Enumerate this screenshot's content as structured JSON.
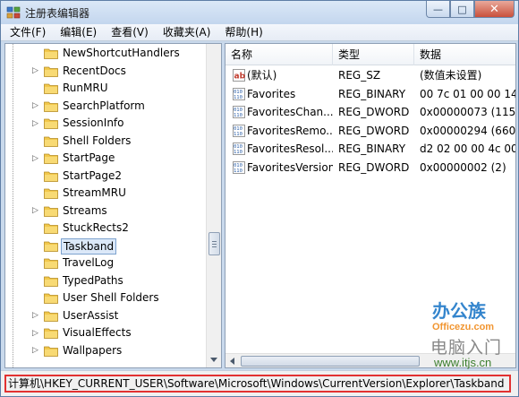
{
  "window": {
    "title": "注册表编辑器",
    "controls": [
      "minimize-icon",
      "maximize-icon",
      "close-icon"
    ],
    "control_glyphs": {
      "minimize": "—",
      "maximize": "□",
      "close": "✕"
    }
  },
  "menu": [
    "文件(F)",
    "编辑(E)",
    "查看(V)",
    "收藏夹(A)",
    "帮助(H)"
  ],
  "tree": {
    "items": [
      {
        "label": "NewShortcutHandlers",
        "expandable": false
      },
      {
        "label": "RecentDocs",
        "expandable": true
      },
      {
        "label": "RunMRU",
        "expandable": false
      },
      {
        "label": "SearchPlatform",
        "expandable": true
      },
      {
        "label": "SessionInfo",
        "expandable": true
      },
      {
        "label": "Shell Folders",
        "expandable": false
      },
      {
        "label": "StartPage",
        "expandable": true
      },
      {
        "label": "StartPage2",
        "expandable": false
      },
      {
        "label": "StreamMRU",
        "expandable": false
      },
      {
        "label": "Streams",
        "expandable": true
      },
      {
        "label": "StuckRects2",
        "expandable": false
      },
      {
        "label": "Taskband",
        "expandable": false,
        "selected": true
      },
      {
        "label": "TravelLog",
        "expandable": false
      },
      {
        "label": "TypedPaths",
        "expandable": false
      },
      {
        "label": "User Shell Folders",
        "expandable": false
      },
      {
        "label": "UserAssist",
        "expandable": true
      },
      {
        "label": "VisualEffects",
        "expandable": true
      },
      {
        "label": "Wallpapers",
        "expandable": true
      }
    ]
  },
  "list": {
    "columns": [
      "名称",
      "类型",
      "数据"
    ],
    "rows": [
      {
        "icon": "string-value-icon",
        "name": "(默认)",
        "type": "REG_SZ",
        "data": "(数值未设置)"
      },
      {
        "icon": "binary-value-icon",
        "name": "Favorites",
        "type": "REG_BINARY",
        "data": "00 7c 01 00 00 14 0"
      },
      {
        "icon": "binary-value-icon",
        "name": "FavoritesChan...",
        "type": "REG_DWORD",
        "data": "0x00000073 (115)"
      },
      {
        "icon": "binary-value-icon",
        "name": "FavoritesRemo...",
        "type": "REG_DWORD",
        "data": "0x00000294 (660)"
      },
      {
        "icon": "binary-value-icon",
        "name": "FavoritesResol...",
        "type": "REG_BINARY",
        "data": "d2 02 00 00 4c 00"
      },
      {
        "icon": "binary-value-icon",
        "name": "FavoritesVersion",
        "type": "REG_DWORD",
        "data": "0x00000002 (2)"
      }
    ]
  },
  "statusbar": {
    "path": "计算机\\HKEY_CURRENT_USER\\Software\\Microsoft\\Windows\\CurrentVersion\\Explorer\\Taskband"
  },
  "watermarks": {
    "brand1": "办公族",
    "brand1_url": "Officezu.com",
    "brand2": "电脑入门",
    "brand2_url": "www.itjs.cn"
  },
  "colors": {
    "selection": "#dbe8f8",
    "status_highlight": "#e23131",
    "folder": "#f2c84b"
  }
}
